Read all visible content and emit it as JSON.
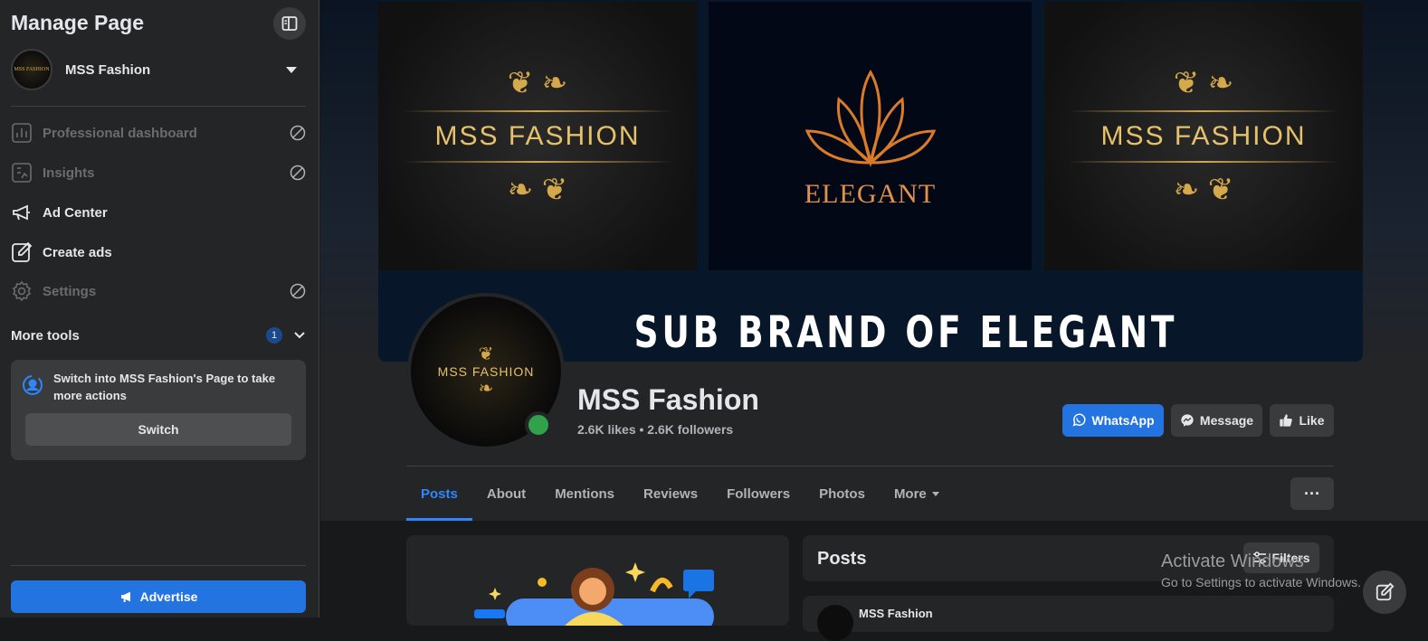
{
  "sidebar": {
    "title": "Manage Page",
    "page_name": "MSS Fashion",
    "avatar_text": "MSS FASHION",
    "menu": [
      {
        "label": "Professional dashboard",
        "icon": "bar-chart-icon",
        "disabled": true
      },
      {
        "label": "Insights",
        "icon": "insights-icon",
        "disabled": true
      },
      {
        "label": "Ad Center",
        "icon": "megaphone-icon",
        "disabled": false
      },
      {
        "label": "Create ads",
        "icon": "edit-icon",
        "disabled": false
      },
      {
        "label": "Settings",
        "icon": "gear-icon",
        "disabled": true
      }
    ],
    "more_tools": {
      "label": "More tools",
      "badge": "1"
    },
    "switch_card": {
      "text": "Switch into MSS Fashion's Page to take more actions",
      "button": "Switch"
    },
    "advertise": "Advertise"
  },
  "cover": {
    "left_brand": "MSS FASHION",
    "right_brand": "MSS FASHION",
    "center_brand": "ELEGANT",
    "tagline": "SUB BRAND OF ELEGANT"
  },
  "profile": {
    "avatar_text": "MSS FASHION",
    "name": "MSS Fashion",
    "stats": "2.6K likes • 2.6K followers",
    "buttons": {
      "whatsapp": "WhatsApp",
      "message": "Message",
      "like": "Like"
    }
  },
  "tabs": [
    {
      "label": "Posts",
      "active": true
    },
    {
      "label": "About"
    },
    {
      "label": "Mentions"
    },
    {
      "label": "Reviews"
    },
    {
      "label": "Followers"
    },
    {
      "label": "Photos"
    },
    {
      "label": "More",
      "dropdown": true
    }
  ],
  "more_options": "···",
  "posts_card": {
    "title": "Posts",
    "filters": "Filters"
  },
  "post_preview": {
    "author": "MSS Fashion"
  },
  "watermark": {
    "line1": "Activate Windows",
    "line2": "Go to Settings to activate Windows."
  },
  "colors": {
    "accent": "#2374e1",
    "online": "#31a24c",
    "gold": "#d4a84b"
  }
}
